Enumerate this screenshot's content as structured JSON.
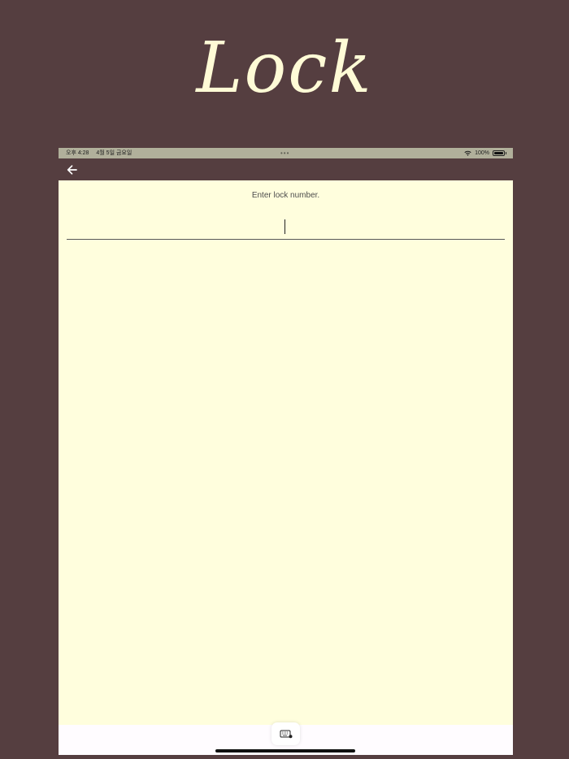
{
  "hero": {
    "title": "Lock"
  },
  "status_bar": {
    "time": "오후 4:28",
    "date": "4월 5일 금요일",
    "dots": "•••",
    "battery_percent": "100%"
  },
  "screen": {
    "prompt": "Enter lock number.",
    "input_value": "",
    "input_placeholder": ""
  },
  "colors": {
    "background": "#553e40",
    "hero_text": "#fffbd6",
    "content_background": "#fffedd",
    "status_bar": "#b1b09b"
  },
  "icons": {
    "back": "back-arrow-icon",
    "keyboard": "keyboard-icon",
    "wifi": "wifi-icon",
    "battery": "battery-icon"
  }
}
